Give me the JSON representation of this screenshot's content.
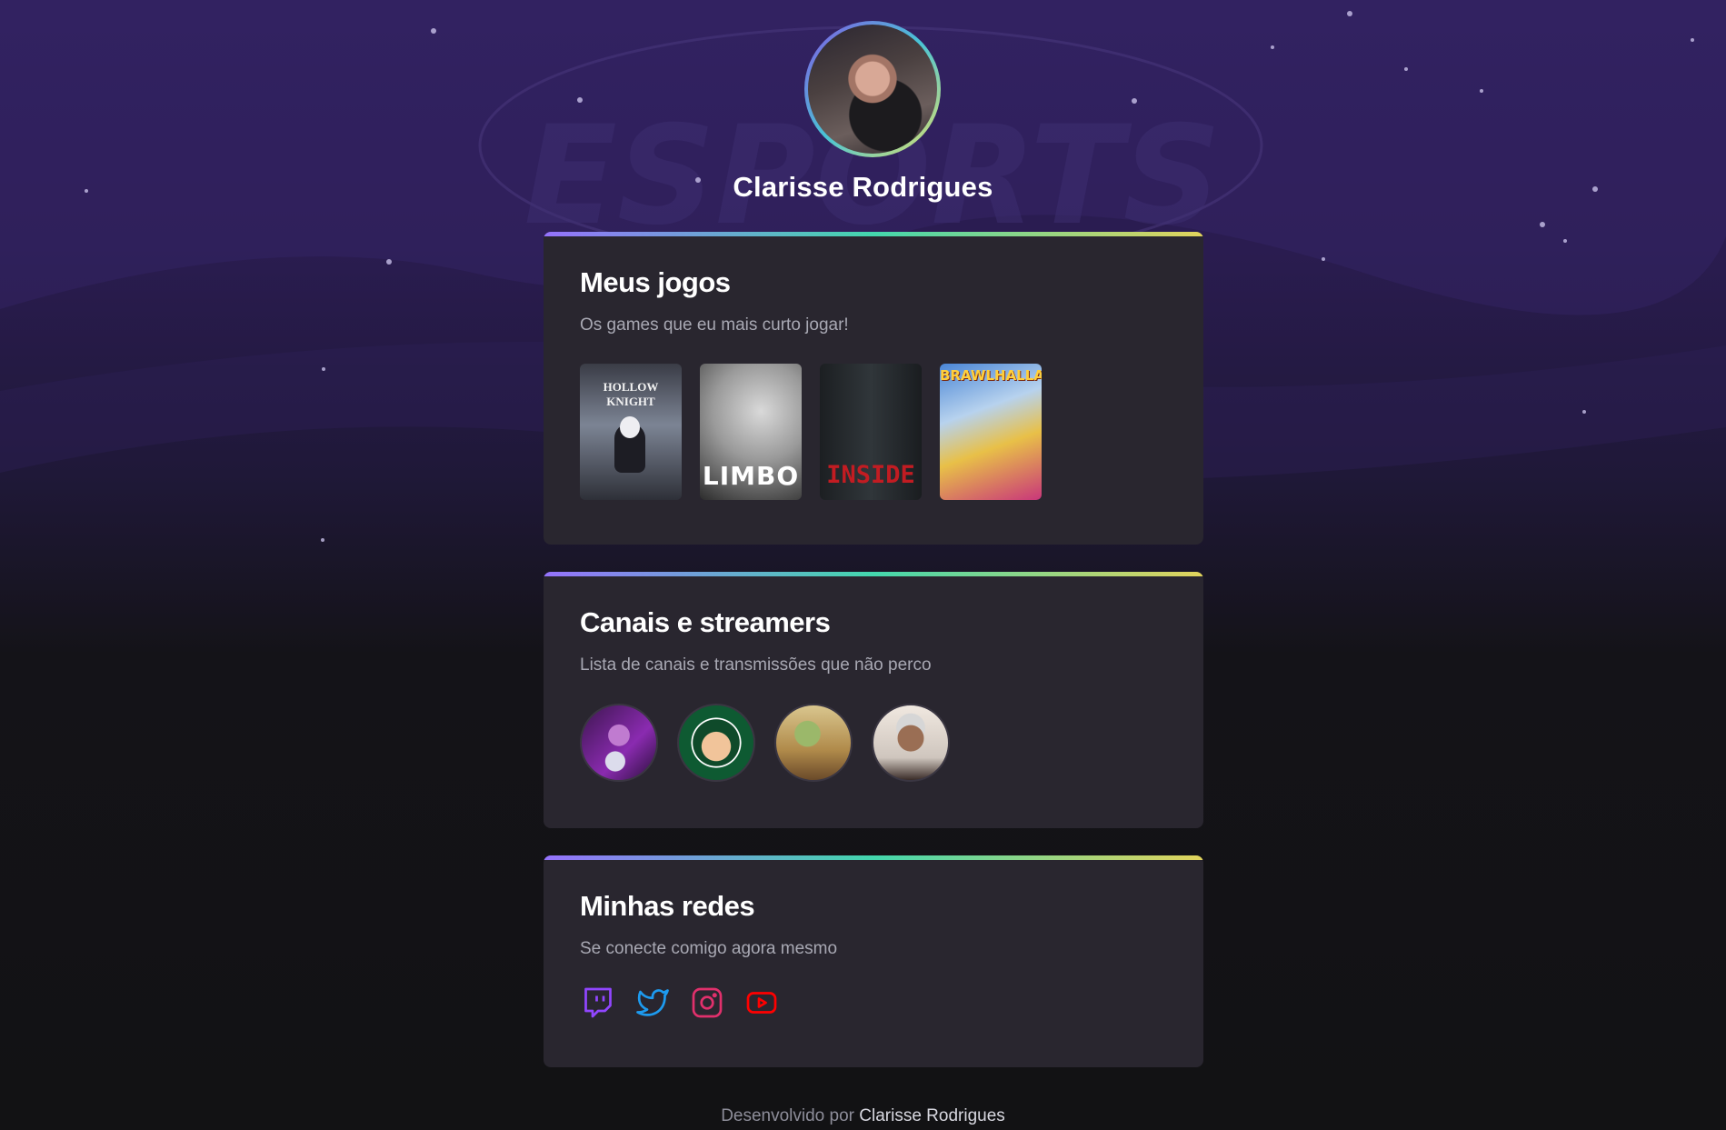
{
  "profile": {
    "name": "Clarisse Rodrigues"
  },
  "games_card": {
    "title": "Meus jogos",
    "subtitle": "Os games que eu mais curto jogar!",
    "games": [
      {
        "label": "HOLLOW KNIGHT"
      },
      {
        "label": "LIMBO"
      },
      {
        "label": "INSIDE"
      },
      {
        "label": "BRAWLHALLA"
      }
    ]
  },
  "streamers_card": {
    "title": "Canais e streamers",
    "subtitle": "Lista de canais e transmissões que não perco"
  },
  "social_card": {
    "title": "Minhas redes",
    "subtitle": "Se conecte comigo agora mesmo",
    "icons": [
      "twitch-icon",
      "twitter-icon",
      "instagram-icon",
      "youtube-icon"
    ]
  },
  "footer": {
    "prefix": "Desenvolvido por",
    "author": "Clarisse Rodrigues"
  },
  "colors": {
    "accent_gradient": [
      "#9572fc",
      "#43d7ad",
      "#e2d45c"
    ],
    "card_bg": "#29262f",
    "twitch": "#9146ff",
    "twitter": "#1d9bf0",
    "instagram": "#e1306c",
    "youtube": "#ff0000"
  }
}
